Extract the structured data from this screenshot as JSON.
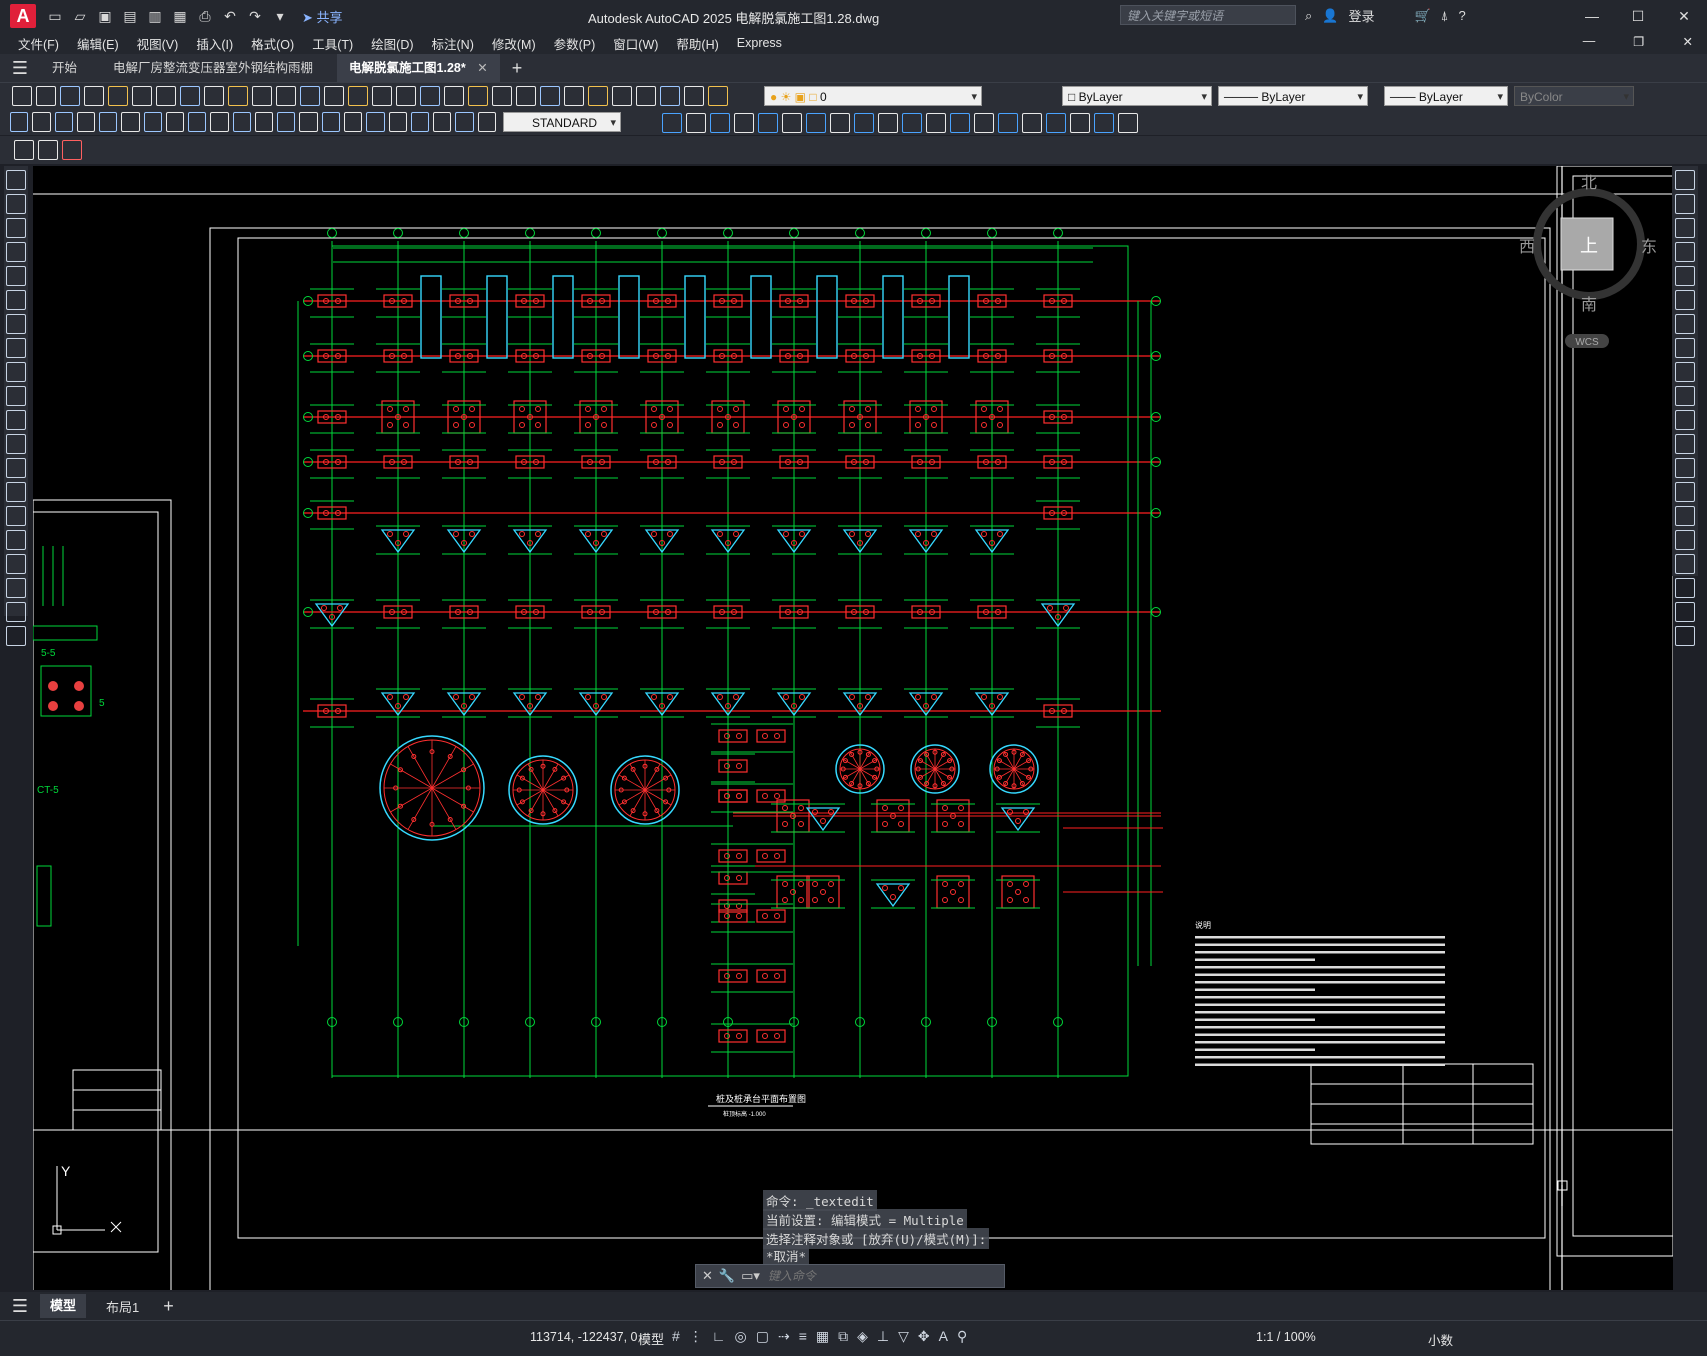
{
  "app": {
    "logo_letter": "A",
    "title": "Autodesk AutoCAD 2025    电解脱氯施工图1.28.dwg",
    "share_label": "共享"
  },
  "search": {
    "placeholder": "键入关键字或短语"
  },
  "user": {
    "login_label": "登录"
  },
  "menu": [
    "文件(F)",
    "编辑(E)",
    "视图(V)",
    "插入(I)",
    "格式(O)",
    "工具(T)",
    "绘图(D)",
    "标注(N)",
    "修改(M)",
    "参数(P)",
    "窗口(W)",
    "帮助(H)",
    "Express"
  ],
  "tabs": [
    {
      "label": "开始"
    },
    {
      "label": "电解厂房整流变压器室外钢结构雨棚"
    },
    {
      "label": "电解脱氯施工图1.28*"
    }
  ],
  "layer": {
    "current": "0"
  },
  "properties": {
    "color": "ByLayer",
    "linetype": "ByLayer",
    "lineweight": "ByLayer",
    "plotstyle": "ByColor"
  },
  "textstyle": {
    "current": "STANDARD"
  },
  "viewcube": {
    "north": "北",
    "south": "南",
    "west": "西",
    "east": "东",
    "top": "上",
    "wcs": "WCS"
  },
  "ucs": {
    "y": "Y",
    "x": "X"
  },
  "drawing": {
    "title": "桩及桩承台平面布置图",
    "scale": "桩顶标高 -1.000",
    "left_section1": "5-5",
    "left_section2": "CT-5",
    "left_label": "5",
    "notes_title": "说明",
    "grid_top": [
      "1",
      "2",
      "3",
      "4",
      "5",
      "6",
      "7",
      "8",
      "9",
      "10",
      "11",
      "12"
    ],
    "grid_left": [
      "F",
      "E",
      "D",
      "C",
      "B",
      "A"
    ]
  },
  "command": {
    "history": [
      "命令: _textedit",
      "当前设置: 编辑模式 = Multiple",
      "选择注释对象或 [放弃(U)/模式(M)]:",
      "*取消*"
    ],
    "placeholder": "键入命令"
  },
  "layouts": [
    {
      "label": "模型"
    },
    {
      "label": "布局1"
    }
  ],
  "status": {
    "coords": "113714, -122437, 0",
    "mode": "模型",
    "scale": "1:1 / 100%",
    "units": "小数"
  }
}
